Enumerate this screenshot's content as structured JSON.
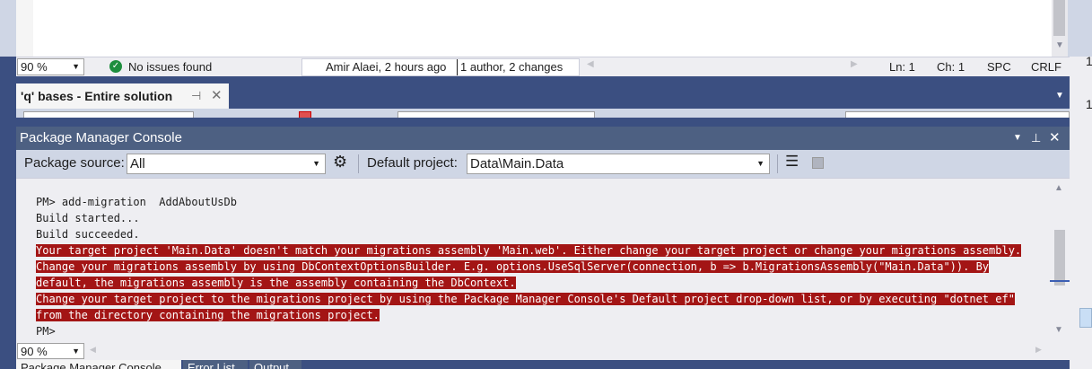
{
  "editor": {
    "zoom": "90 %",
    "issues": "No issues found",
    "blame": "Amir Alaei, 2 hours ago",
    "blame_authors": "1 author, 2 changes",
    "line": "Ln: 1",
    "col": "Ch: 1",
    "indent": "SPC",
    "eol": "CRLF"
  },
  "find_tab": {
    "label": "'q' bases - Entire solution"
  },
  "pmc": {
    "title": "Package Manager Console",
    "package_source_label": "Package source:",
    "package_source_value": "All",
    "default_project_label": "Default project:",
    "default_project_value": "Data\\Main.Data",
    "zoom": "90 %",
    "lines": {
      "cmd": "PM> add-migration  AddAboutUsDb",
      "build_started": "Build started...",
      "build_succeeded": "Build succeeded.",
      "err1": "Your target project 'Main.Data' doesn't match your migrations assembly 'Main.web'. Either change your target project or change your migrations assembly.",
      "err2": "Change your migrations assembly by using DbContextOptionsBuilder. E.g. options.UseSqlServer(connection, b => b.MigrationsAssembly(\"Main.Data\")). By",
      "err3": "default, the migrations assembly is the assembly containing the DbContext.",
      "err4": "Change your target project to the migrations project by using the Package Manager Console's Default project drop-down list, or by executing \"dotnet ef\"",
      "err5": "from the directory containing the migrations project.",
      "prompt": "PM>"
    }
  },
  "bottom_tabs": {
    "pmc": "Package Manager Console",
    "errors": "Error List",
    "output": "Output"
  },
  "colors": {
    "error_bg": "#a31515",
    "chrome": "#3b4f81",
    "panel_title": "#4d6082"
  }
}
